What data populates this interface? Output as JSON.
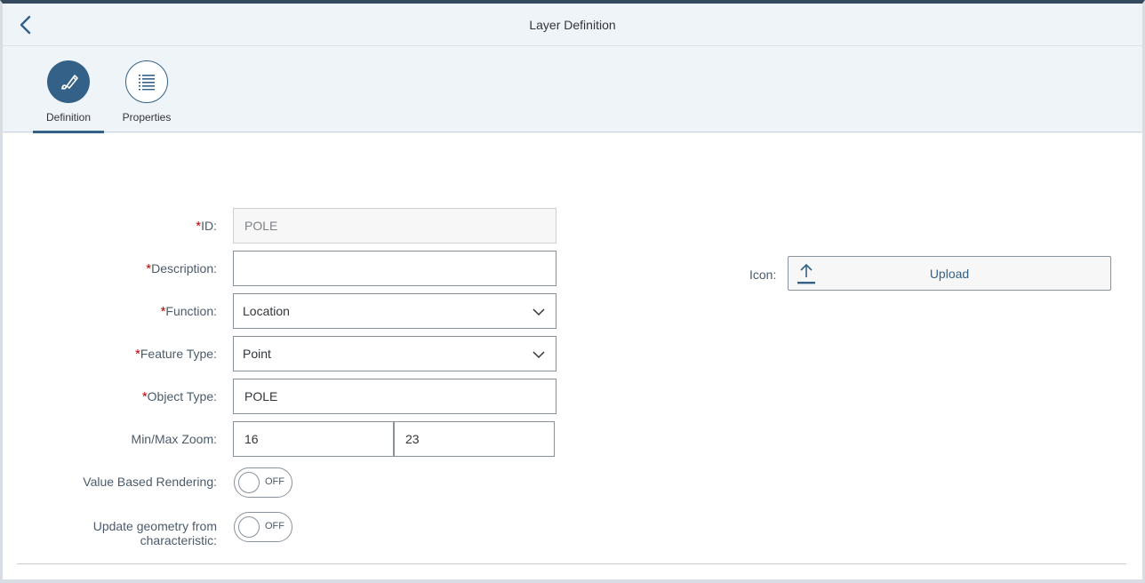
{
  "header": {
    "title": "Layer Definition"
  },
  "tabs": [
    {
      "label": "Definition",
      "icon": "edit-pencil-icon",
      "active": true
    },
    {
      "label": "Properties",
      "icon": "list-icon",
      "active": false
    }
  ],
  "form": {
    "id": {
      "label": "ID:",
      "value": "POLE",
      "required": "*"
    },
    "description": {
      "label": "Description:",
      "value": "",
      "required": "*"
    },
    "function": {
      "label": "Function:",
      "value": "Location",
      "required": "*"
    },
    "feature_type": {
      "label": "Feature Type:",
      "value": "Point",
      "required": "*"
    },
    "object_type": {
      "label": "Object Type:",
      "value": "POLE",
      "required": "*"
    },
    "zoom": {
      "label": "Min/Max Zoom:",
      "min": "16",
      "max": "23"
    },
    "value_based_rendering": {
      "label": "Value Based Rendering:",
      "state": "OFF"
    },
    "update_geometry": {
      "label_line1": "Update geometry from",
      "label_line2": "characteristic:",
      "state": "OFF"
    }
  },
  "icon_field": {
    "label": "Icon:",
    "button_label": "Upload"
  },
  "colors": {
    "accent": "#346187",
    "header_bg": "#eff4f9",
    "required": "#bb0000"
  }
}
